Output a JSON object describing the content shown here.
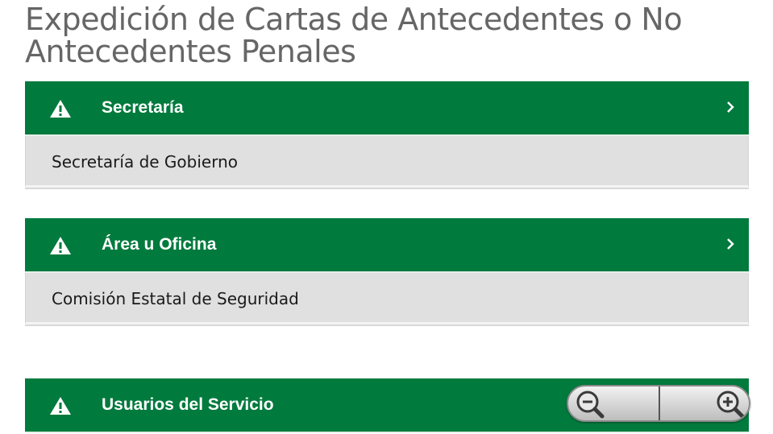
{
  "page": {
    "title": "Expedición de Cartas de Antecedentes o No Antecedentes Penales"
  },
  "sections": [
    {
      "label": "Secretaría",
      "value": "Secretaría de Gobierno",
      "icon": "warning-icon"
    },
    {
      "label": "Área u Oficina",
      "value": "Comisión Estatal de Seguridad",
      "icon": "warning-icon"
    },
    {
      "label": "Usuarios del Servicio",
      "icon": "warning-icon"
    }
  ],
  "colors": {
    "header_green": "#007a3d",
    "body_gray": "#e0e0e0",
    "title_gray": "#666666"
  },
  "zoom": {
    "out_icon": "zoom-out-icon",
    "in_icon": "zoom-in-icon"
  }
}
